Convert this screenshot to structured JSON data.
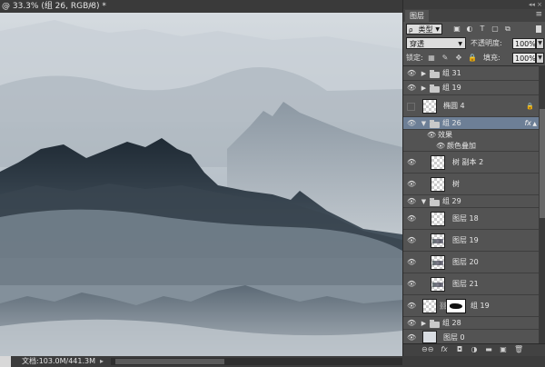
{
  "document": {
    "tab_title": "@ 33.3% (组 26, RGB/8) *",
    "close_glyph": "×"
  },
  "status": {
    "doc_info": "文档:103.0M/441.3M",
    "arrow": "▸"
  },
  "layers_panel": {
    "tab_label": "图层",
    "menu_glyph": "≡",
    "top_controls": "◂◂ ×",
    "filter": {
      "kind_icon": "ρ",
      "kind_label": "类型",
      "icons": [
        "pixel-filter-icon",
        "adjustment-filter-icon",
        "type-filter-icon",
        "shape-filter-icon",
        "smart-object-filter-icon"
      ],
      "icon_glyphs": [
        "▣",
        "◐",
        "T",
        "▢",
        "⧉"
      ]
    },
    "blend_mode": "穿透",
    "opacity_label": "不透明度:",
    "opacity_value": "100%",
    "lock_label": "锁定:",
    "lock_glyphs": [
      "▦",
      "✎",
      "✥",
      "🔒"
    ],
    "fill_label": "填充:",
    "fill_value": "100%",
    "layers": [
      {
        "name": "组 31",
        "type": "group",
        "expanded": false,
        "visible": true
      },
      {
        "name": "组 19",
        "type": "group",
        "expanded": false,
        "visible": true
      },
      {
        "name": "椭圆 4",
        "type": "shape",
        "visible": false,
        "locked": true
      },
      {
        "name": "组 26",
        "type": "group",
        "expanded": true,
        "visible": true,
        "selected": true,
        "fx": "fx"
      },
      {
        "name": "效果",
        "type": "effects",
        "visible": true
      },
      {
        "name": "颜色叠加",
        "type": "effect",
        "visible": true
      },
      {
        "name": "树 副本 2",
        "type": "pixel",
        "visible": true
      },
      {
        "name": "树",
        "type": "pixel",
        "visible": true
      },
      {
        "name": "组 29",
        "type": "group",
        "expanded": true,
        "visible": true
      },
      {
        "name": "图层 18",
        "type": "pixel",
        "visible": true
      },
      {
        "name": "图层 19",
        "type": "pixel",
        "visible": true
      },
      {
        "name": "图层 20",
        "type": "pixel",
        "visible": true
      },
      {
        "name": "图层 21",
        "type": "pixel",
        "visible": true
      },
      {
        "name": "组 19",
        "type": "group-mask",
        "visible": true
      },
      {
        "name": "组 28",
        "type": "group",
        "expanded": false,
        "visible": true
      },
      {
        "name": "图层 0",
        "type": "pixel",
        "visible": true
      }
    ],
    "bottom_icons": [
      "link-layers-icon",
      "fx-icon",
      "add-mask-icon",
      "adjustment-layer-icon",
      "new-group-icon",
      "new-layer-icon",
      "delete-layer-icon"
    ],
    "bottom_glyphs": [
      "⊖⊖",
      "fx",
      "◘",
      "◑",
      "▬",
      "▣",
      "🗑"
    ]
  },
  "colors": {
    "panel_bg": "#535353",
    "selected_row": "#6d7f96",
    "canvas_sky": "#b9c1c8",
    "mountain_dark": "#26323d"
  }
}
